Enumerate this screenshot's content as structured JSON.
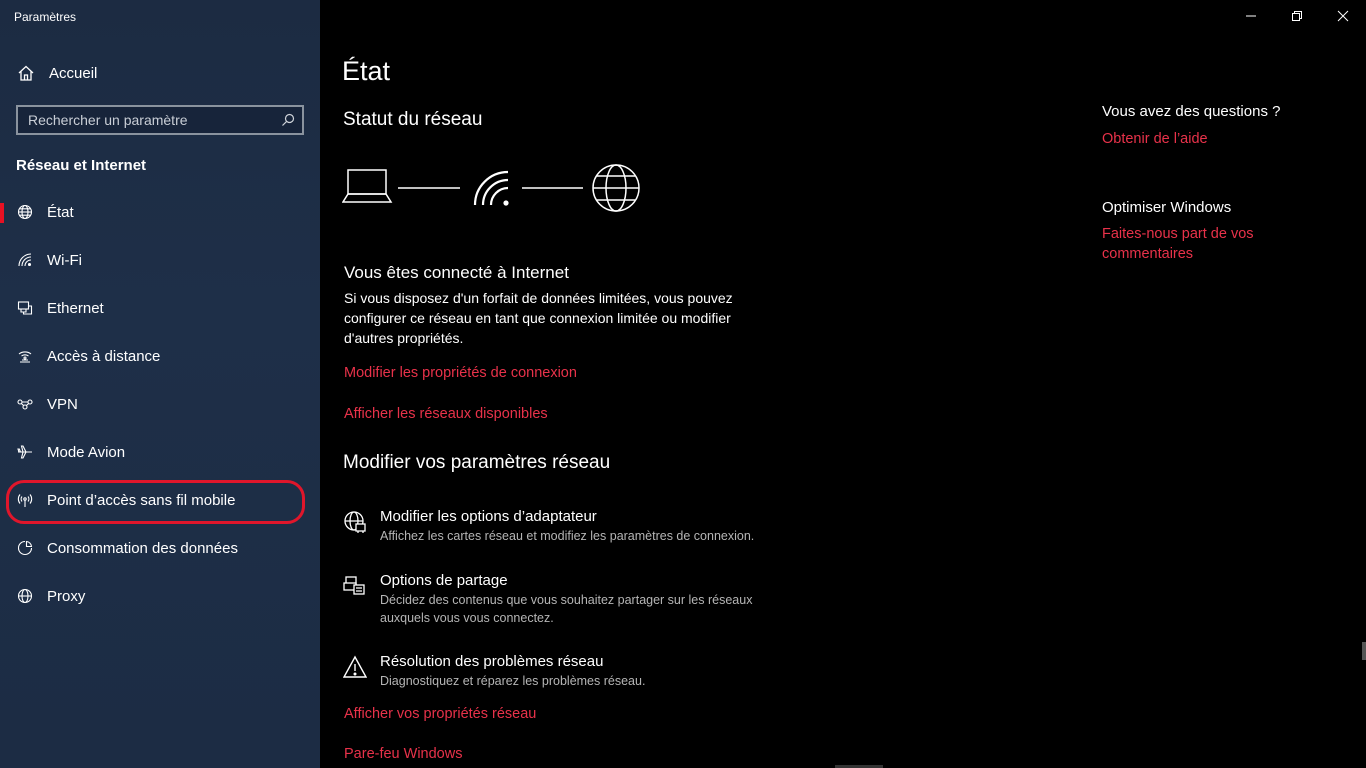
{
  "window": {
    "title": "Paramètres"
  },
  "sidebar": {
    "home_label": "Accueil",
    "search_placeholder": "Rechercher un paramètre",
    "section_title": "Réseau et Internet",
    "items": [
      {
        "label": "État",
        "icon": "globe-icon",
        "active": true
      },
      {
        "label": "Wi-Fi",
        "icon": "wifi-icon"
      },
      {
        "label": "Ethernet",
        "icon": "ethernet-icon"
      },
      {
        "label": "Accès à distance",
        "icon": "dialup-icon"
      },
      {
        "label": "VPN",
        "icon": "vpn-icon"
      },
      {
        "label": "Mode Avion",
        "icon": "airplane-icon"
      },
      {
        "label": "Point d’accès sans fil mobile",
        "icon": "hotspot-icon"
      },
      {
        "label": "Consommation des données",
        "icon": "data-usage-icon"
      },
      {
        "label": "Proxy",
        "icon": "globe-icon"
      }
    ]
  },
  "main": {
    "page_title": "État",
    "network_status_heading": "Statut du réseau",
    "connection_title": "Vous êtes connecté à Internet",
    "connection_desc": "Si vous disposez d'un forfait de données limitées, vous pouvez configurer ce réseau en tant que connexion limitée ou modifier d'autres propriétés.",
    "link_change_props": "Modifier les propriétés de connexion",
    "link_show_networks": "Afficher les réseaux disponibles",
    "modify_heading": "Modifier vos paramètres réseau",
    "settings": [
      {
        "title": "Modifier les options d’adaptateur",
        "desc": "Affichez les cartes réseau et modifiez les paramètres de connexion.",
        "icon": "adapter-icon"
      },
      {
        "title": "Options de partage",
        "desc": "Décidez des contenus que vous souhaitez partager sur les réseaux auxquels vous vous connectez.",
        "icon": "sharing-icon"
      },
      {
        "title": "Résolution des problèmes réseau",
        "desc": "Diagnostiquez et réparez les problèmes réseau.",
        "icon": "warning-icon"
      }
    ],
    "link_network_props": "Afficher vos propriétés réseau",
    "link_firewall": "Pare-feu Windows"
  },
  "right": {
    "questions_heading": "Vous avez des questions ?",
    "help_link": "Obtenir de l’aide",
    "optimize_heading": "Optimiser Windows",
    "feedback_link_line1": "Faites-nous part de vos",
    "feedback_link_line2": "commentaires"
  },
  "colors": {
    "accent": "#e8324a",
    "sidebar_bg": "#1e2f48",
    "highlight": "#e0162b"
  }
}
